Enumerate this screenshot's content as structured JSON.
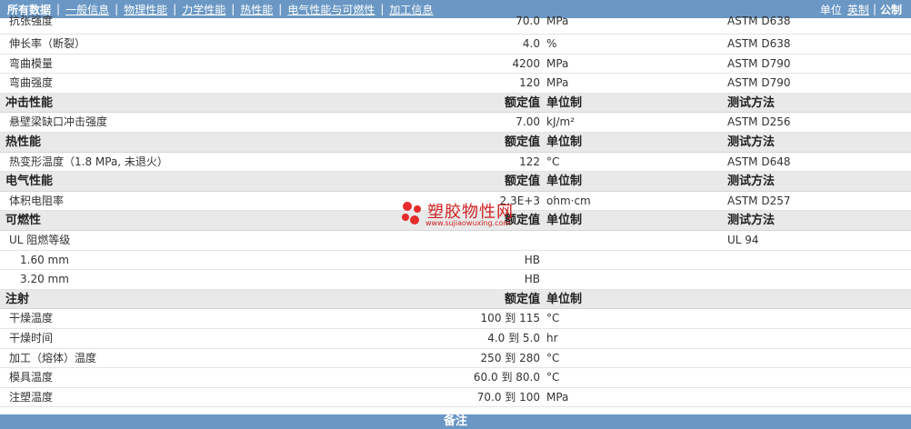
{
  "nav": {
    "items": [
      "所有数据",
      "一般信息",
      "物理性能",
      "力学性能",
      "热性能",
      "电气性能与可燃性",
      "加工信息"
    ],
    "active_index": 0
  },
  "units": {
    "label": "单位",
    "imperial": "英制",
    "sep": "|",
    "metric": "公制"
  },
  "header_cols": {
    "value": "额定值",
    "unit": "单位制",
    "method": "测试方法"
  },
  "rows": [
    {
      "type": "data",
      "name": "抗张强度",
      "value": "70.0",
      "unit": "MPa",
      "method": "ASTM D638",
      "clipped": true
    },
    {
      "type": "data",
      "name": "伸长率（断裂）",
      "value": "4.0",
      "unit": "%",
      "method": "ASTM D638"
    },
    {
      "type": "data",
      "name": "弯曲模量",
      "value": "4200",
      "unit": "MPa",
      "method": "ASTM D790"
    },
    {
      "type": "data",
      "name": "弯曲强度",
      "value": "120",
      "unit": "MPa",
      "method": "ASTM D790"
    },
    {
      "type": "section",
      "name": "冲击性能",
      "value": "额定值",
      "unit": "单位制",
      "method": "测试方法"
    },
    {
      "type": "data",
      "name": "悬壁梁缺口冲击强度",
      "value": "7.00",
      "unit": "kJ/m²",
      "method": "ASTM D256"
    },
    {
      "type": "section",
      "name": "热性能",
      "value": "额定值",
      "unit": "单位制",
      "method": "测试方法"
    },
    {
      "type": "data",
      "name": "热变形温度（1.8 MPa, 未退火）",
      "value": "122",
      "unit": "°C",
      "method": "ASTM D648"
    },
    {
      "type": "section",
      "name": "电气性能",
      "value": "额定值",
      "unit": "单位制",
      "method": "测试方法"
    },
    {
      "type": "data",
      "name": "体积电阻率",
      "value": "2.3E+3",
      "unit": "ohm·cm",
      "method": "ASTM D257"
    },
    {
      "type": "section",
      "name": "可燃性",
      "value": "额定值",
      "unit": "单位制",
      "method": "测试方法"
    },
    {
      "type": "data",
      "name": "UL 阻燃等级",
      "value": "",
      "unit": "",
      "method": "UL 94"
    },
    {
      "type": "data",
      "name": "1.60 mm",
      "value": "HB",
      "unit": "",
      "method": "",
      "indent": true
    },
    {
      "type": "data",
      "name": "3.20 mm",
      "value": "HB",
      "unit": "",
      "method": "",
      "indent": true
    },
    {
      "type": "section",
      "name": "注射",
      "value": "额定值",
      "unit": "单位制",
      "method": ""
    },
    {
      "type": "data",
      "name": "干燥温度",
      "value": "100 到  115",
      "unit": "°C",
      "method": ""
    },
    {
      "type": "data",
      "name": "干燥时间",
      "value": "4.0 到  5.0",
      "unit": "hr",
      "method": ""
    },
    {
      "type": "data",
      "name": "加工（熔体）温度",
      "value": "250 到  280",
      "unit": "°C",
      "method": ""
    },
    {
      "type": "data",
      "name": "模具温度",
      "value": "60.0 到  80.0",
      "unit": "°C",
      "method": ""
    },
    {
      "type": "data",
      "name": "注塑温度",
      "value": "70.0 到  100",
      "unit": "MPa",
      "method": ""
    }
  ],
  "footer": {
    "label": "备注"
  },
  "watermark": {
    "text": "塑胶物性网",
    "url": "www.sujiaowuxing.com"
  },
  "colors": {
    "bar": "#6a97c4",
    "section_bg": "#e9e9e9",
    "watermark": "#d22020"
  }
}
